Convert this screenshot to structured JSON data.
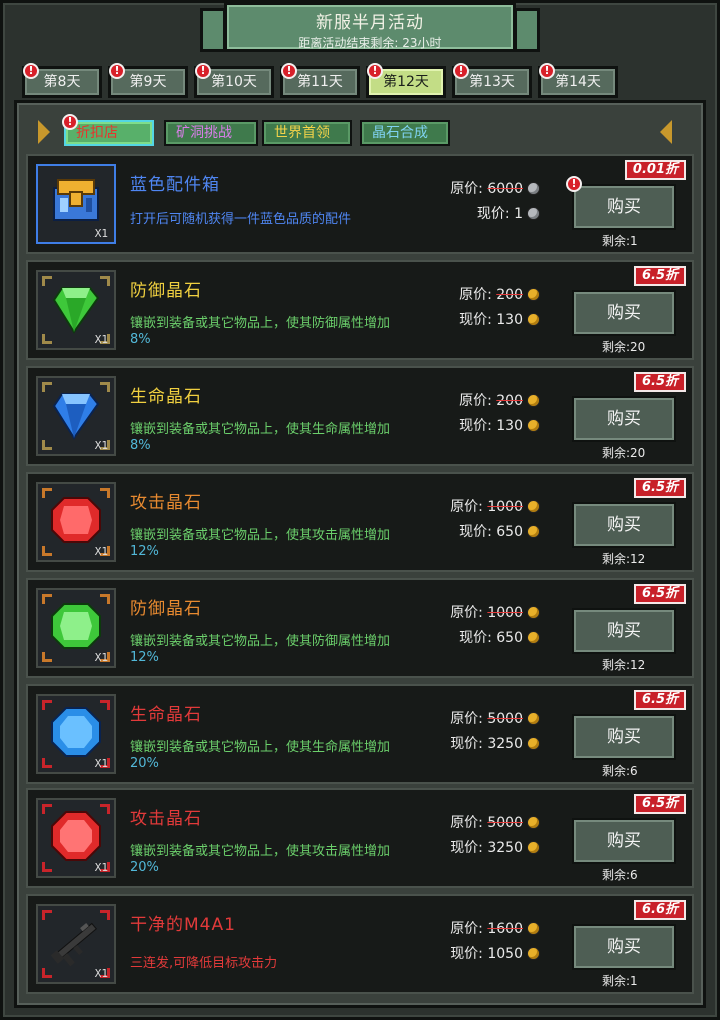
{
  "header": {
    "title": "新服半月活动",
    "subtitle": "距离活动结束剩余: 23小时"
  },
  "tabs": [
    {
      "label": "第8天",
      "badge": "!"
    },
    {
      "label": "第9天",
      "badge": "!"
    },
    {
      "label": "第10天",
      "badge": "!"
    },
    {
      "label": "第11天",
      "badge": "!"
    },
    {
      "label": "第12天",
      "badge": "!",
      "active": true
    },
    {
      "label": "第13天",
      "badge": "!"
    },
    {
      "label": "第14天",
      "badge": "!"
    }
  ],
  "categories": [
    {
      "label": "折扣店",
      "badge": "!",
      "active": true,
      "color": "#e4362e"
    },
    {
      "label": "矿洞挑战",
      "color": "#d87ee8"
    },
    {
      "label": "世界首领",
      "color": "#f2d34a"
    },
    {
      "label": "晶石合成",
      "color": "#7fd2f0"
    }
  ],
  "labels": {
    "original_price": "原价:",
    "current_price": "现价:",
    "buy": "购买",
    "remaining_prefix": "剩余:",
    "quantity": "X1"
  },
  "items": [
    {
      "name": "蓝色配件箱",
      "name_color": "#4f86f2",
      "desc": "打开后可随机获得一件蓝色品质的配件",
      "desc_pct": "",
      "desc_color": "#4f86f2",
      "orig": "6000",
      "now": "1",
      "currency": "silver",
      "discount": "0.01折",
      "remaining": "1",
      "buy_badge": "!",
      "icon": "box-icon",
      "frame_color": "#3f7ee6"
    },
    {
      "name": "防御晶石",
      "name_color": "#f0d040",
      "desc": "镶嵌到装备或其它物品上，使其防御属性增加",
      "desc_pct": "8%",
      "desc_color": "#6bcf6b",
      "orig": "200",
      "now": "130",
      "currency": "gold",
      "discount": "6.5折",
      "remaining": "20",
      "icon": "green-crystal-icon",
      "frame_color": "#a08a4a"
    },
    {
      "name": "生命晶石",
      "name_color": "#f0d040",
      "desc": "镶嵌到装备或其它物品上，使其生命属性增加",
      "desc_pct": "8%",
      "desc_color": "#6bcf6b",
      "orig": "200",
      "now": "130",
      "currency": "gold",
      "discount": "6.5折",
      "remaining": "20",
      "icon": "blue-crystal-icon",
      "frame_color": "#a08a4a"
    },
    {
      "name": "攻击晶石",
      "name_color": "#e88a30",
      "desc": "镶嵌到装备或其它物品上，使其攻击属性增加",
      "desc_pct": "12%",
      "desc_color": "#6bcf6b",
      "orig": "1000",
      "now": "650",
      "currency": "gold",
      "discount": "6.5折",
      "remaining": "12",
      "icon": "red-gem-icon",
      "frame_color": "#c8782a"
    },
    {
      "name": "防御晶石",
      "name_color": "#e88a30",
      "desc": "镶嵌到装备或其它物品上，使其防御属性增加",
      "desc_pct": "12%",
      "desc_color": "#6bcf6b",
      "orig": "1000",
      "now": "650",
      "currency": "gold",
      "discount": "6.5折",
      "remaining": "12",
      "icon": "green-gem-icon",
      "frame_color": "#c8782a"
    },
    {
      "name": "生命晶石",
      "name_color": "#e23a3a",
      "desc": "镶嵌到装备或其它物品上，使其生命属性增加",
      "desc_pct": "20%",
      "desc_color": "#6bcf6b",
      "orig": "5000",
      "now": "3250",
      "currency": "gold",
      "discount": "6.5折",
      "remaining": "6",
      "icon": "blue-octagon-gem-icon",
      "frame_color": "#c8242a"
    },
    {
      "name": "攻击晶石",
      "name_color": "#e23a3a",
      "desc": "镶嵌到装备或其它物品上，使其攻击属性增加",
      "desc_pct": "20%",
      "desc_color": "#6bcf6b",
      "orig": "5000",
      "now": "3250",
      "currency": "gold",
      "discount": "6.5折",
      "remaining": "6",
      "icon": "red-octagon-gem-icon",
      "frame_color": "#c8242a"
    },
    {
      "name": "干净的M4A1",
      "name_color": "#e23a3a",
      "desc": "三连发,可降低目标攻击力",
      "desc_pct": "",
      "desc_color": "#e23a3a",
      "orig": "1600",
      "now": "1050",
      "currency": "gold",
      "discount": "6.6折",
      "remaining": "1",
      "icon": "rifle-icon",
      "frame_color": "#c8242a"
    }
  ]
}
